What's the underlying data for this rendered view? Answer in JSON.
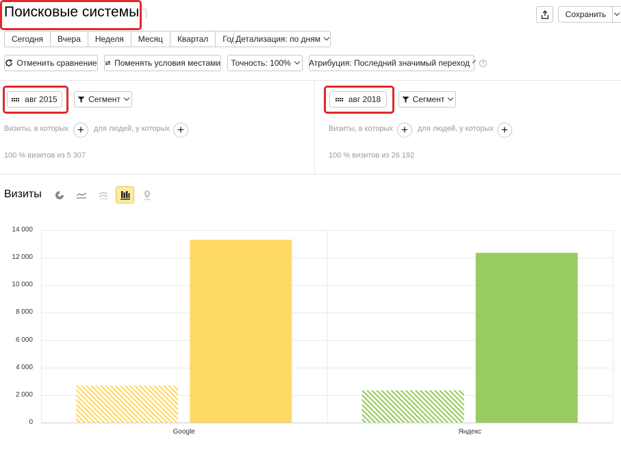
{
  "header": {
    "title": "Поисковые системы",
    "save_label": "Сохранить"
  },
  "periods": [
    "Сегодня",
    "Вчера",
    "Неделя",
    "Месяц",
    "Квартал",
    "Год"
  ],
  "detail_dropdown": "Детализация: по дням",
  "toolbar": {
    "cancel_compare": "Отменить сравнение",
    "swap_conditions": "Поменять условия местами",
    "accuracy": "Точность: 100%",
    "attribution": "Атрибуция: Последний значимый переход"
  },
  "panels": [
    {
      "date_label": "авг 2015",
      "segment_label": "Сегмент",
      "visits_condition": "Визиты, в которых",
      "people_condition": "для людей, у которых",
      "summary": "100 % визитов из 5 307"
    },
    {
      "date_label": "авг 2018",
      "segment_label": "Сегмент",
      "visits_condition": "Визиты, в которых",
      "people_condition": "для людей, у которых",
      "summary": "100 % визитов из 26 192"
    }
  ],
  "chart_section": {
    "title": "Визиты",
    "view_icons": [
      "pie-chart-icon",
      "line-chart-icon",
      "stacked-area-icon",
      "bar-chart-icon",
      "map-icon"
    ],
    "active_view": "bar-chart-icon"
  },
  "chart_data": {
    "type": "bar",
    "categories": [
      "Google",
      "Яндекс"
    ],
    "series": [
      {
        "values": [
          2700,
          2350
        ],
        "pattern": "hatched"
      },
      {
        "values": [
          13300,
          12350
        ],
        "pattern": "solid"
      }
    ],
    "category_colors": {
      "Google": "#ffd966",
      "Яндекс": "#98cc60"
    },
    "yticks": [
      "14 000",
      "12 000",
      "10 000",
      "8 000",
      "6 000",
      "4 000",
      "2 000",
      "0"
    ],
    "ylim": [
      0,
      14000
    ],
    "grid": true
  },
  "colors": {
    "highlight": "#e0282a",
    "google": "#ffd966",
    "yandex": "#98cc60",
    "active_view_bg": "#fdeaa7"
  }
}
